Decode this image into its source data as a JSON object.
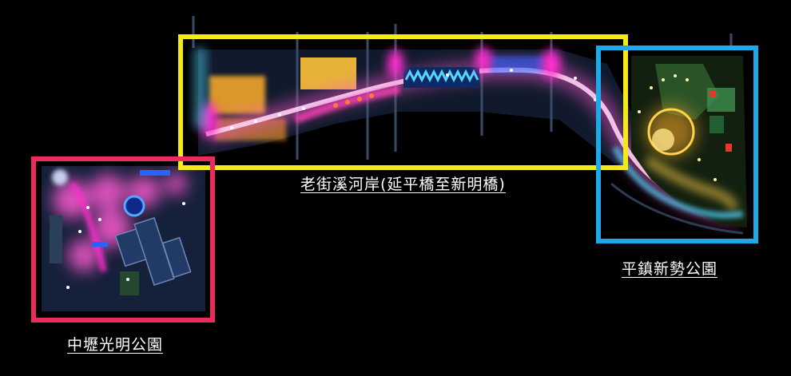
{
  "map": {
    "background": "#000000",
    "zones": [
      {
        "id": "river",
        "label": "老街溪河岸(延平橋至新明橋)",
        "frame_color": "#f4ea19"
      },
      {
        "id": "xinshi",
        "label": "平鎮新勢公園",
        "frame_color": "#1fa9e8"
      },
      {
        "id": "guangming",
        "label": "中壢光明公園",
        "frame_color": "#ec2a5c"
      }
    ],
    "light_colors": {
      "pink": "#ff5ad2",
      "magenta": "#ff2fd0",
      "orange": "#ffae2b",
      "amber": "#ffd24a",
      "cyan": "#52d6ff",
      "blue": "#2a62ff",
      "green": "#3f8f4e"
    }
  }
}
